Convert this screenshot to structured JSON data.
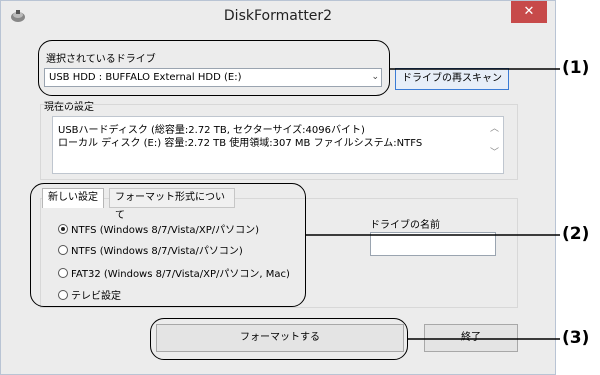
{
  "window": {
    "title": "DiskFormatter2",
    "close_glyph": "✕",
    "icon": "app-logo-icon"
  },
  "drive_select": {
    "label": "選択されているドライブ",
    "selected": "USB HDD : BUFFALO  External HDD      (E:)",
    "rescan_button": "ドライブの再スキャン"
  },
  "current_settings": {
    "label": "現在の設定",
    "line1": "USBハードディスク (総容量:2.72 TB, セクターサイズ:4096バイト)",
    "line2": "ローカル ディスク (E:)      容量:2.72 TB  使用領域:307 MB  ファイルシステム:NTFS"
  },
  "new_settings": {
    "tabs": [
      "新しい設定",
      "フォーマット形式について"
    ],
    "options": [
      {
        "label": "NTFS (Windows 8/7/Vista/XP/パソコン)",
        "selected": true
      },
      {
        "label": "NTFS (Windows 8/7/Vista/パソコン)",
        "selected": false
      },
      {
        "label": "FAT32 (Windows 8/7/Vista/XP/パソコン, Mac)",
        "selected": false
      },
      {
        "label": "テレビ設定",
        "selected": false
      }
    ],
    "drive_name_label": "ドライブの名前",
    "drive_name_value": ""
  },
  "actions": {
    "format_button": "フォーマットする",
    "exit_button": "終了"
  },
  "callouts": [
    "(1)",
    "(2)",
    "(3)"
  ]
}
